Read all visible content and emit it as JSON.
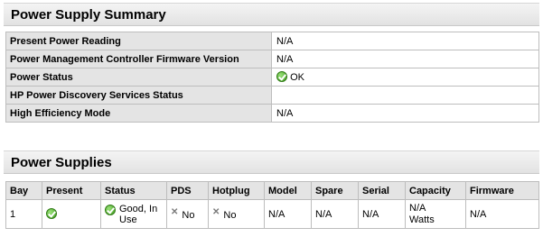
{
  "summary": {
    "title": "Power Supply Summary",
    "rows": [
      {
        "label": "Present Power Reading",
        "value": "N/A"
      },
      {
        "label": "Power Management Controller Firmware Version",
        "value": "N/A"
      },
      {
        "label": "Power Status",
        "value": "OK",
        "icon": "ok-check-icon"
      },
      {
        "label": "HP Power Discovery Services Status",
        "value": ""
      },
      {
        "label": "High Efficiency Mode",
        "value": "N/A"
      }
    ]
  },
  "supplies": {
    "title": "Power Supplies",
    "headers": [
      "Bay",
      "Present",
      "Status",
      "PDS",
      "Hotplug",
      "Model",
      "Spare",
      "Serial",
      "Capacity",
      "Firmware"
    ],
    "rows": [
      {
        "bay": "1",
        "present_icon": "ok-check-icon",
        "status_line1": "Good, In",
        "status_line2": "Use",
        "pds": "No",
        "hotplug": "No",
        "model": "N/A",
        "spare": "N/A",
        "serial": "N/A",
        "capacity_line1": "N/A",
        "capacity_line2": "Watts",
        "firmware": "N/A"
      }
    ]
  },
  "colors": {
    "ok_green": "#4caf2a",
    "header_bg": "#e4e4e4",
    "border": "#bdbdbd"
  }
}
